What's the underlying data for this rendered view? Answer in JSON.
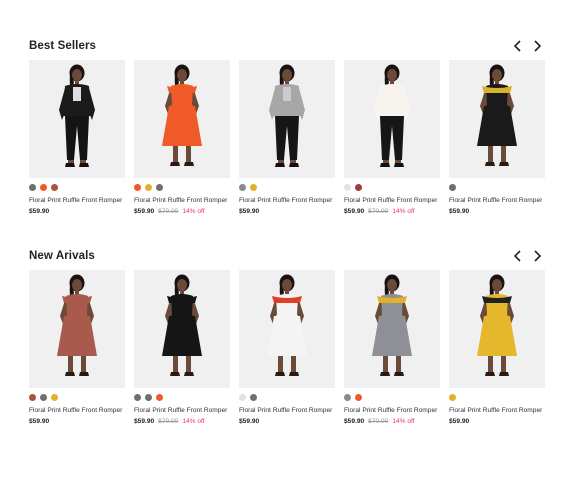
{
  "colors": {
    "grey": "#6f6f6f",
    "orange": "#f05a28",
    "brown": "#a9533a",
    "yellow": "#e2b02a",
    "light": "#e2e2e2",
    "burgundy": "#9d3b3e",
    "discount": "#e8336e"
  },
  "sections": [
    {
      "title": "Best Sellers",
      "prev_icon": "chevron-left-icon",
      "next_icon": "chevron-right-icon",
      "products": [
        {
          "name": "Floral Print Ruffle Front Romper",
          "price": "$59.90",
          "old_price": "",
          "discount": "",
          "swatches": [
            "#6f6f6f",
            "#f05a28",
            "#a9533a"
          ],
          "outfit": {
            "top": "#1b1b1b",
            "bottom": "#141414",
            "accent": "#f5f5f5",
            "style": "pants"
          }
        },
        {
          "name": "Floral Print Ruffle Front Romper",
          "price": "$59.90",
          "old_price": "$70.00",
          "discount": "14% off",
          "swatches": [
            "#f05a28",
            "#e2b02a",
            "#6f6f6f"
          ],
          "outfit": {
            "top": "#f05a28",
            "bottom": "#f05a28",
            "accent": "#f05a28",
            "style": "dress"
          }
        },
        {
          "name": "Floral Print Ruffle Front Romper",
          "price": "$59.90",
          "old_price": "",
          "discount": "",
          "swatches": [
            "#8a8a8a",
            "#e2b02a"
          ],
          "outfit": {
            "top": "#a7a7a7",
            "bottom": "#161616",
            "accent": "#cfcfcf",
            "style": "pants"
          }
        },
        {
          "name": "Floral Print Ruffle Front Romper",
          "price": "$59.90",
          "old_price": "$70.00",
          "discount": "14% off",
          "swatches": [
            "#e2e2e2",
            "#9d3b3e"
          ],
          "outfit": {
            "top": "#f7f3ee",
            "bottom": "#161616",
            "accent": "#f7f3ee",
            "style": "pants"
          }
        },
        {
          "name": "Floral Print Ruffle Front Romper",
          "price": "$59.90",
          "old_price": "",
          "discount": "",
          "swatches": [
            "#6f6f6f"
          ],
          "outfit": {
            "top": "#1a1a1a",
            "bottom": "#1a1a1a",
            "accent": "#d8b02a",
            "style": "dress"
          }
        }
      ]
    },
    {
      "title": "New Arivals",
      "prev_icon": "chevron-left-icon",
      "next_icon": "chevron-right-icon",
      "products": [
        {
          "name": "Floral Print Ruffle Front Romper",
          "price": "$59.90",
          "old_price": "",
          "discount": "",
          "swatches": [
            "#a9533a",
            "#6f6f6f",
            "#e2b02a"
          ],
          "outfit": {
            "top": "#a85a4c",
            "bottom": "#a85a4c",
            "accent": "#a85a4c",
            "style": "dress"
          }
        },
        {
          "name": "Floral Print Ruffle Front Romper",
          "price": "$59.90",
          "old_price": "$70.00",
          "discount": "14% off",
          "swatches": [
            "#6f6f6f",
            "#6f6f6f",
            "#f05a28"
          ],
          "outfit": {
            "top": "#151515",
            "bottom": "#151515",
            "accent": "#151515",
            "style": "dress"
          }
        },
        {
          "name": "Floral Print Ruffle Front Romper",
          "price": "$59.90",
          "old_price": "",
          "discount": "",
          "swatches": [
            "#e2e2e2",
            "#6f6f6f"
          ],
          "outfit": {
            "top": "#f4f4f4",
            "bottom": "#f4f4f4",
            "accent": "#e23c2a",
            "style": "dress"
          }
        },
        {
          "name": "Floral Print Ruffle Front Romper",
          "price": "$59.90",
          "old_price": "$70.00",
          "discount": "14% off",
          "swatches": [
            "#8a8a8a",
            "#f05a28"
          ],
          "outfit": {
            "top": "#8f8f96",
            "bottom": "#8f8f96",
            "accent": "#e2b02a",
            "style": "dress"
          }
        },
        {
          "name": "Floral Print Ruffle Front Romper",
          "price": "$59.90",
          "old_price": "",
          "discount": "",
          "swatches": [
            "#e2b02a"
          ],
          "outfit": {
            "top": "#e5b72c",
            "bottom": "#e5b72c",
            "accent": "#222222",
            "style": "dress"
          }
        }
      ]
    }
  ]
}
